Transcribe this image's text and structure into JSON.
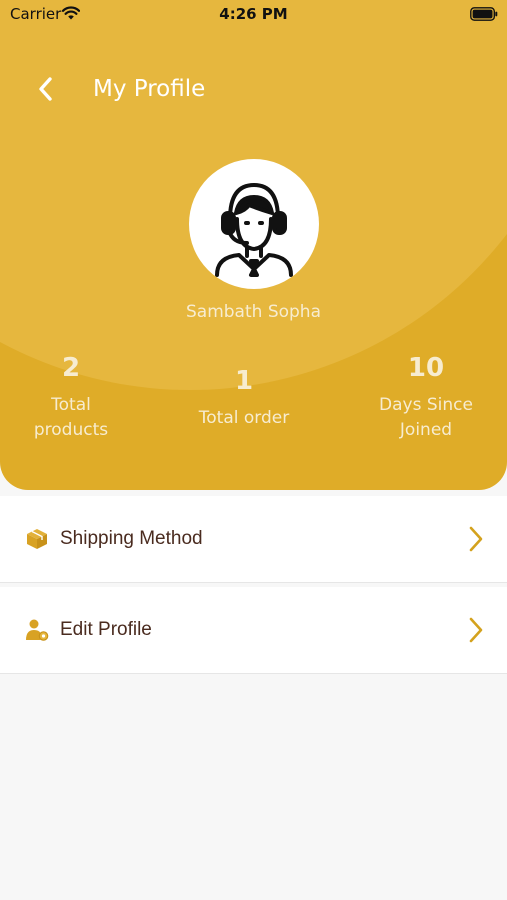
{
  "status_bar": {
    "carrier": "Carrier",
    "time": "4:26 PM",
    "icons": [
      "wifi-icon",
      "battery-icon"
    ]
  },
  "header": {
    "title": "My Profile",
    "back_icon": "chevron-left-icon",
    "background_color": "#dfac28"
  },
  "profile": {
    "name": "Sambath Sopha",
    "avatar_icon": "support-agent-avatar"
  },
  "stats": [
    {
      "value": "2",
      "label_line1": "Total",
      "label_line2": "products"
    },
    {
      "value": "1",
      "label_line1": "Total order",
      "label_line2": ""
    },
    {
      "value": "10",
      "label_line1": "Days Since",
      "label_line2": "Joined"
    }
  ],
  "menu": [
    {
      "label": "Shipping Method",
      "icon": "package-icon"
    },
    {
      "label": "Edit Profile",
      "icon": "user-settings-icon"
    }
  ],
  "colors": {
    "accent": "#dfac28",
    "label_text": "#4a2b1f",
    "chevron": "#d4a21e"
  }
}
